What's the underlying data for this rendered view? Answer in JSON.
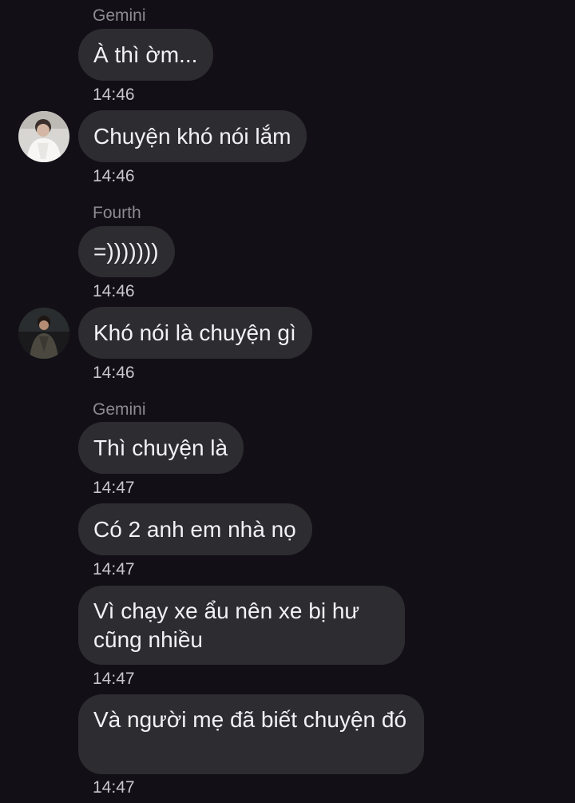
{
  "messages": [
    {
      "sender": "Gemini",
      "text": "À thì ờm...",
      "time": "14:46"
    },
    {
      "text": "Chuyện khó nói lắm",
      "time": "14:46",
      "avatar": "avatar-photo-white-shirt"
    },
    {
      "sender": "Fourth",
      "text": "=)))))))",
      "time": "14:46"
    },
    {
      "text": "Khó nói là chuyện gì",
      "time": "14:46",
      "avatar": "avatar-photo-dark-outfit"
    },
    {
      "sender": "Gemini",
      "text": "Thì chuyện là",
      "time": "14:47"
    },
    {
      "text": "Có 2 anh em nhà nọ",
      "time": "14:47"
    },
    {
      "text": "Vì chạy xe ẩu nên xe bị hư cũng nhiều",
      "time": "14:47"
    },
    {
      "text": "Và người mẹ đã biết chuyện đó",
      "time": "14:47"
    }
  ],
  "colors": {
    "background": "#121016",
    "bubble": "#2d2c31",
    "text": "#f2f1f4",
    "sender": "#8d8b92",
    "time": "#c9c7cd"
  }
}
